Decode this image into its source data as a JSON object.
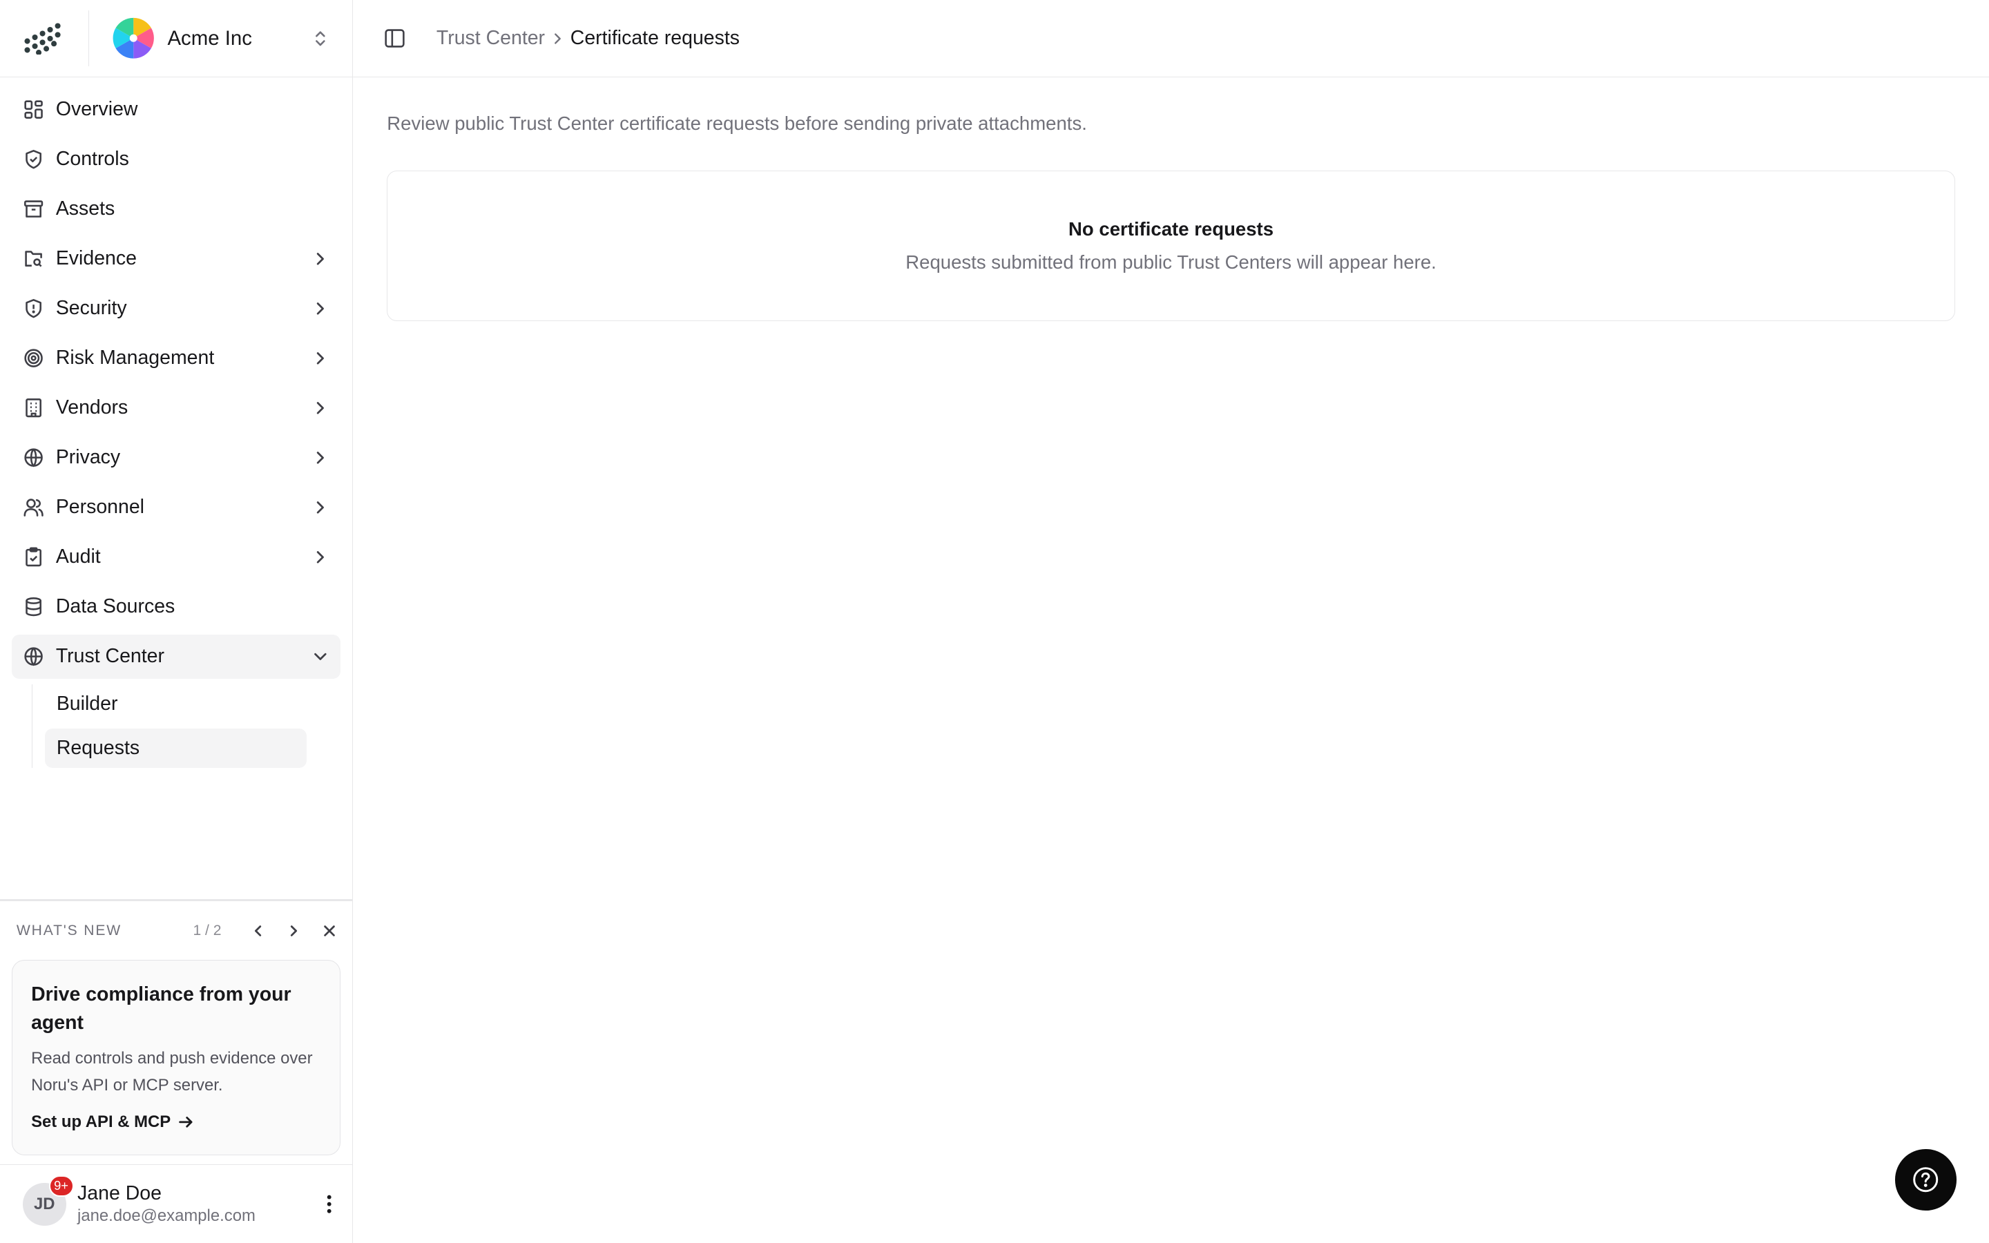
{
  "org": {
    "name": "Acme Inc"
  },
  "sidebar": {
    "items": [
      {
        "label": "Overview"
      },
      {
        "label": "Controls"
      },
      {
        "label": "Assets"
      },
      {
        "label": "Evidence"
      },
      {
        "label": "Security"
      },
      {
        "label": "Risk Management"
      },
      {
        "label": "Vendors"
      },
      {
        "label": "Privacy"
      },
      {
        "label": "Personnel"
      },
      {
        "label": "Audit"
      },
      {
        "label": "Data Sources"
      },
      {
        "label": "Trust Center"
      }
    ],
    "trust_center_sub": [
      {
        "label": "Builder"
      },
      {
        "label": "Requests"
      }
    ]
  },
  "whats_new": {
    "heading": "WHAT'S NEW",
    "pager": "1 / 2",
    "card_title": "Drive compliance from your agent",
    "card_body": "Read controls and push evidence over Noru's API or MCP server.",
    "card_link": "Set up API & MCP"
  },
  "user": {
    "initials": "JD",
    "badge": "9+",
    "name": "Jane Doe",
    "email": "jane.doe@example.com"
  },
  "breadcrumb": {
    "parent": "Trust Center",
    "current": "Certificate requests"
  },
  "main": {
    "description": "Review public Trust Center certificate requests before sending private attachments.",
    "empty_title": "No certificate requests",
    "empty_subtitle": "Requests submitted from public Trust Centers will appear here."
  },
  "colors": {
    "accent_active_bg": "#f4f4f5",
    "badge_red": "#dc2626",
    "help_button": "#0a0a0a"
  }
}
